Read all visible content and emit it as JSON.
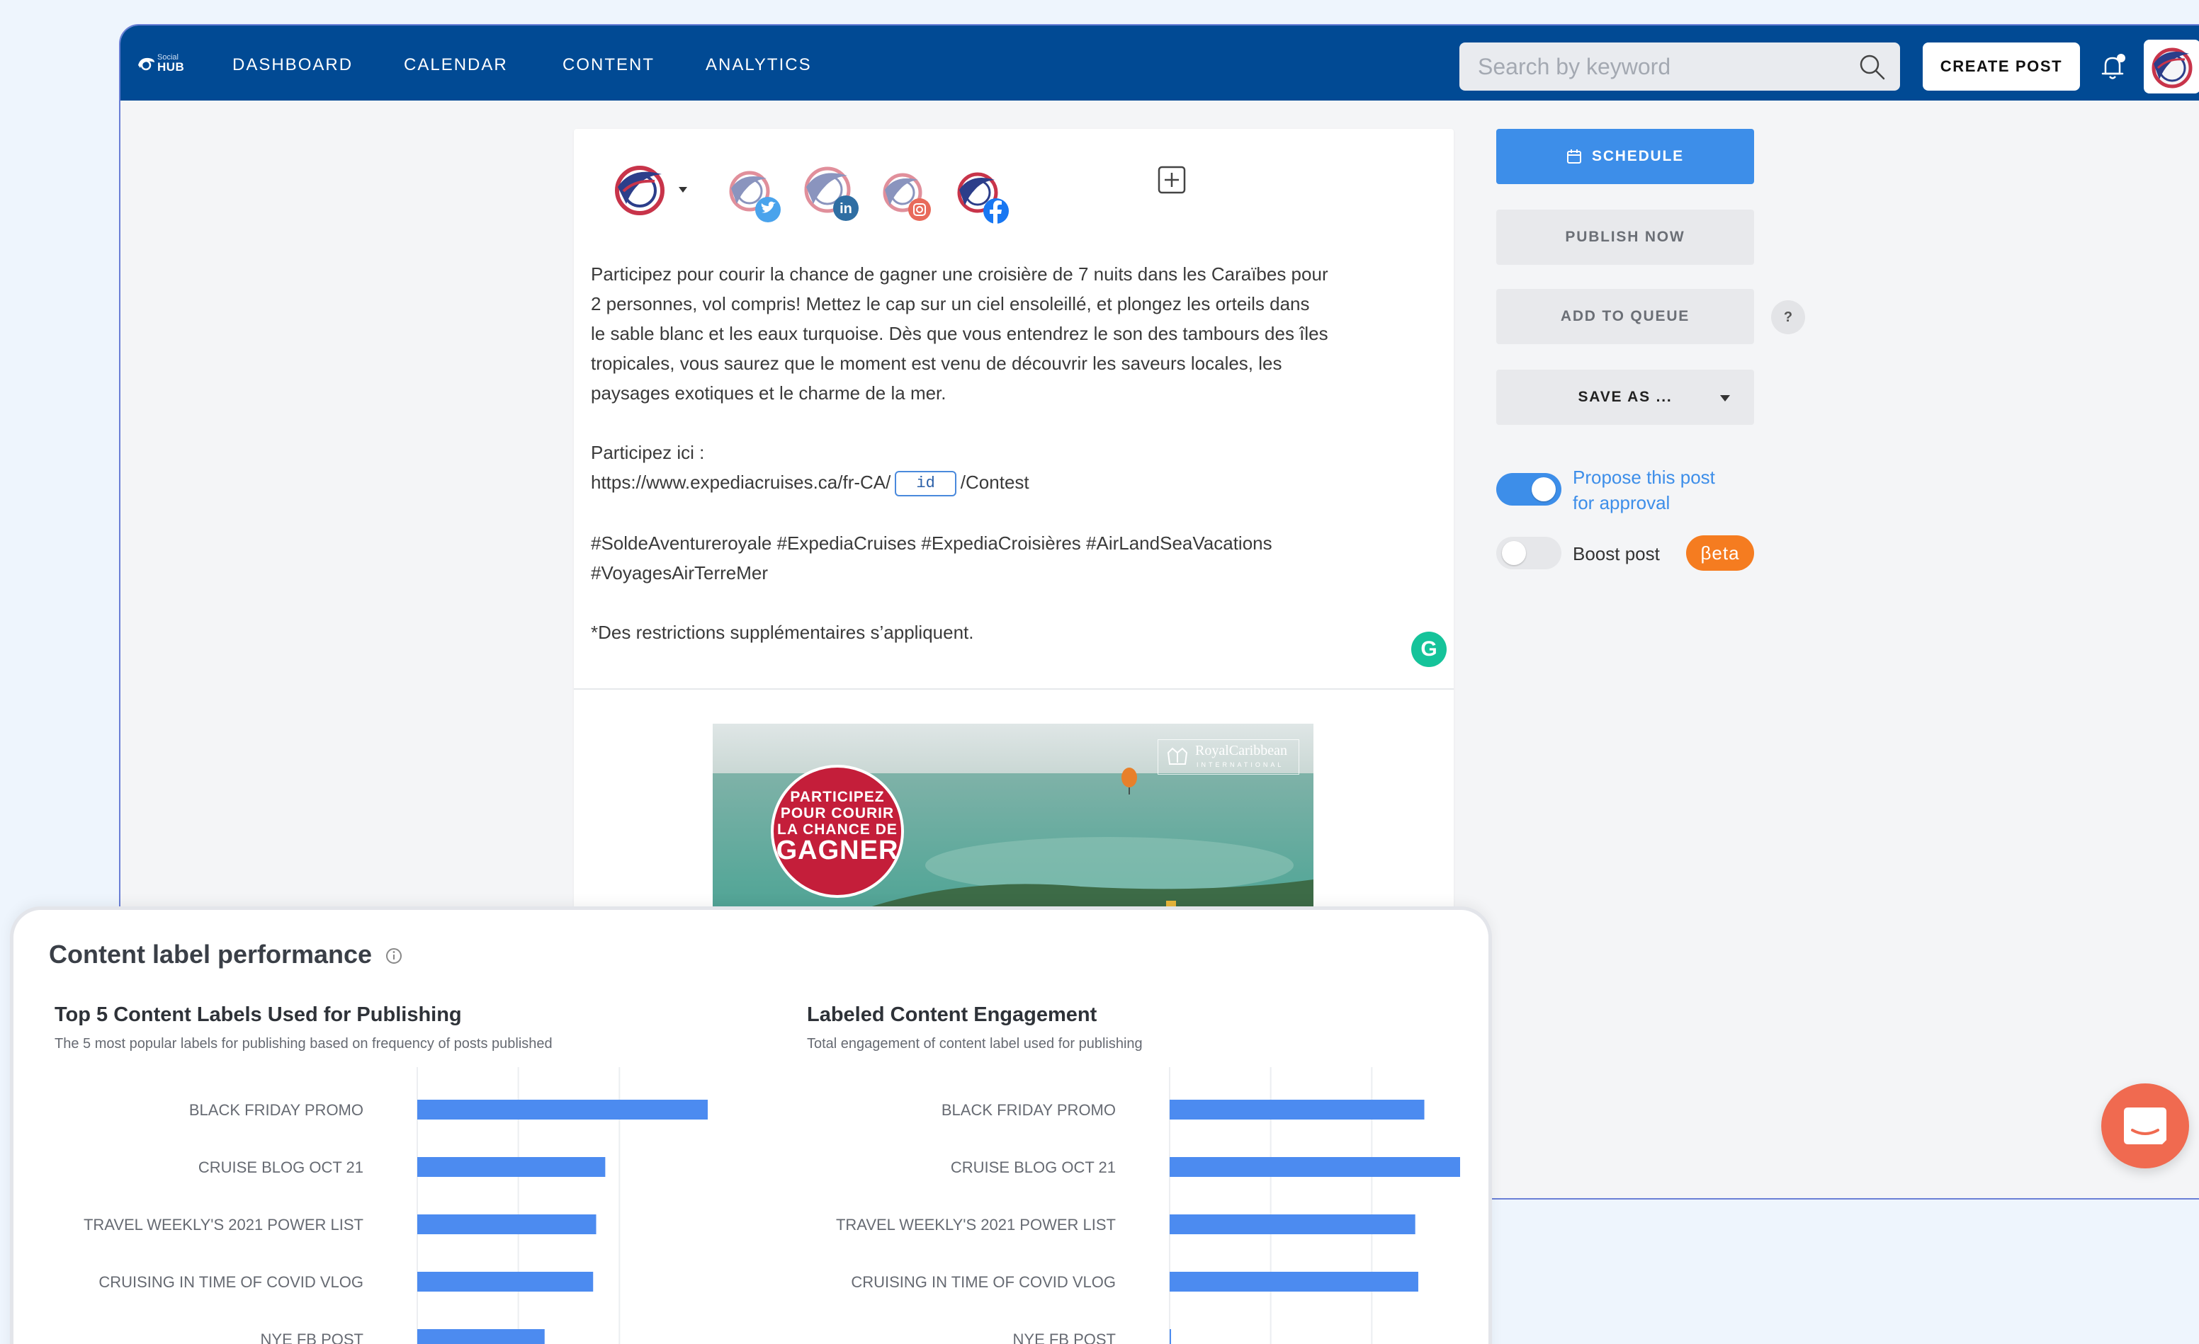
{
  "brand": {
    "logo_small": "Social",
    "logo_big": "HUB"
  },
  "nav": {
    "items": [
      "DASHBOARD",
      "CALENDAR",
      "CONTENT",
      "ANALYTICS"
    ],
    "search_placeholder": "Search by keyword",
    "create_post": "CREATE POST"
  },
  "composer": {
    "accounts": [
      "main-account",
      "twitter",
      "linkedin",
      "instagram",
      "facebook"
    ],
    "lines": [
      "Participez pour courir la chance de gagner une croisière de 7 nuits dans les Caraïbes pour",
      "2 personnes, vol compris! Mettez le cap sur un ciel ensoleillé, et plongez les orteils dans",
      "le sable blanc et les eaux turquoise. Dès que vous entendrez le son des tambours des îles",
      "tropicales, vous saurez que le moment est venu de découvrir les saveurs locales, les",
      "paysages exotiques et le charme de la mer."
    ],
    "participate_label": "Participez ici :",
    "url_prefix": "https://www.expediacruises.ca/fr-CA/",
    "url_token": "id",
    "url_suffix": "/Contest",
    "hashtags_line1": "#SoldeAventureroyale #ExpediaCruises #ExpediaCroisières #AirLandSeaVacations",
    "hashtags_line2": "#VoyagesAirTerreMer",
    "disclaimer": "*Des restrictions supplémentaires s’appliquent.",
    "grammarly_letter": "G",
    "variables_glyph": "{···}",
    "image": {
      "badge_lines": [
        "PARTICIPEZ",
        "POUR COURIR",
        "LA CHANCE DE"
      ],
      "badge_big": "GAGNER",
      "brand_main": "RoyalCaribbean",
      "brand_sub": "INTERNATIONAL"
    }
  },
  "actions": {
    "schedule": "SCHEDULE",
    "publish_now": "PUBLISH NOW",
    "add_to_queue": "ADD TO QUEUE",
    "help": "?",
    "save_as": "SAVE AS ...",
    "propose_line1": "Propose this post",
    "propose_line2": "for approval",
    "propose_on": true,
    "boost": "Boost post",
    "boost_on": false,
    "beta": "βeta"
  },
  "colors": {
    "nav": "#014a94",
    "primary": "#3d8ee9",
    "bar": "#4c8bf0",
    "beta": "#f57c20",
    "chat": "#f06a50",
    "grammarly": "#15c39a"
  },
  "analytics": {
    "title": "Content label performance",
    "chart_data": [
      {
        "type": "bar",
        "orientation": "horizontal",
        "title": "Top 5 Content Labels Used for Publishing",
        "subtitle": "The 5 most popular labels for publishing based on frequency of posts published",
        "categories": [
          "BLACK FRIDAY PROMO",
          "CRUISE BLOG OCT 21",
          "TRAVEL WEEKLY'S 2021 POWER LIST",
          "CRUISING IN TIME OF COVID VLOG",
          "NYE FB POST"
        ],
        "values": [
          100,
          62,
          59,
          58,
          42
        ],
        "xlim": [
          0,
          100
        ],
        "grid": true
      },
      {
        "type": "bar",
        "orientation": "horizontal",
        "title": "Labeled Content Engagement",
        "subtitle": "Total engagement of content label used for publishing",
        "categories": [
          "BLACK FRIDAY PROMO",
          "CRUISE BLOG OCT 21",
          "TRAVEL WEEKLY'S 2021 POWER LIST",
          "CRUISING IN TIME OF COVID VLOG",
          "NYE FB POST"
        ],
        "values": [
          84,
          100,
          81,
          82,
          0
        ],
        "xlim": [
          0,
          100
        ],
        "grid": true
      }
    ]
  }
}
